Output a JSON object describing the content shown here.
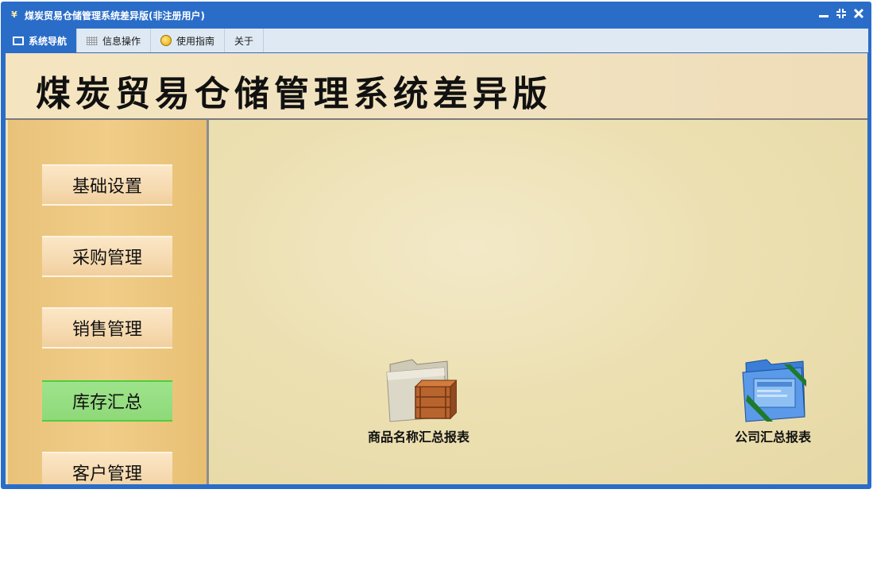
{
  "window": {
    "title": "煤炭贸易仓储管理系统差异版(非注册用户)",
    "logo_glyph": "¥",
    "controls": {
      "minimize": "▁",
      "restore": "⧉",
      "close": "✕"
    }
  },
  "menu": {
    "tabs": [
      {
        "label": "系统导航",
        "icon": "monitor-icon",
        "active": true
      },
      {
        "label": "信息操作",
        "icon": "grid-icon",
        "active": false
      },
      {
        "label": "使用指南",
        "icon": "guide-icon",
        "active": false
      },
      {
        "label": "关于",
        "icon": "",
        "active": false
      }
    ]
  },
  "banner": {
    "title": "煤炭贸易仓储管理系统差异版"
  },
  "sidebar": {
    "items": [
      {
        "label": "基础设置",
        "active": false
      },
      {
        "label": "采购管理",
        "active": false
      },
      {
        "label": "销售管理",
        "active": false
      },
      {
        "label": "库存汇总",
        "active": true
      },
      {
        "label": "客户管理",
        "active": false
      }
    ]
  },
  "reports": [
    {
      "label": "商品名称汇总报表",
      "icon": "folder-crate-icon"
    },
    {
      "label": "公司汇总报表",
      "icon": "blue-folder-icon"
    }
  ],
  "colors": {
    "titlebar": "#2a6dc8",
    "sidebar": "#ecc67f",
    "active_item": "#8ed97a",
    "main_bg": "#ece0b2"
  }
}
